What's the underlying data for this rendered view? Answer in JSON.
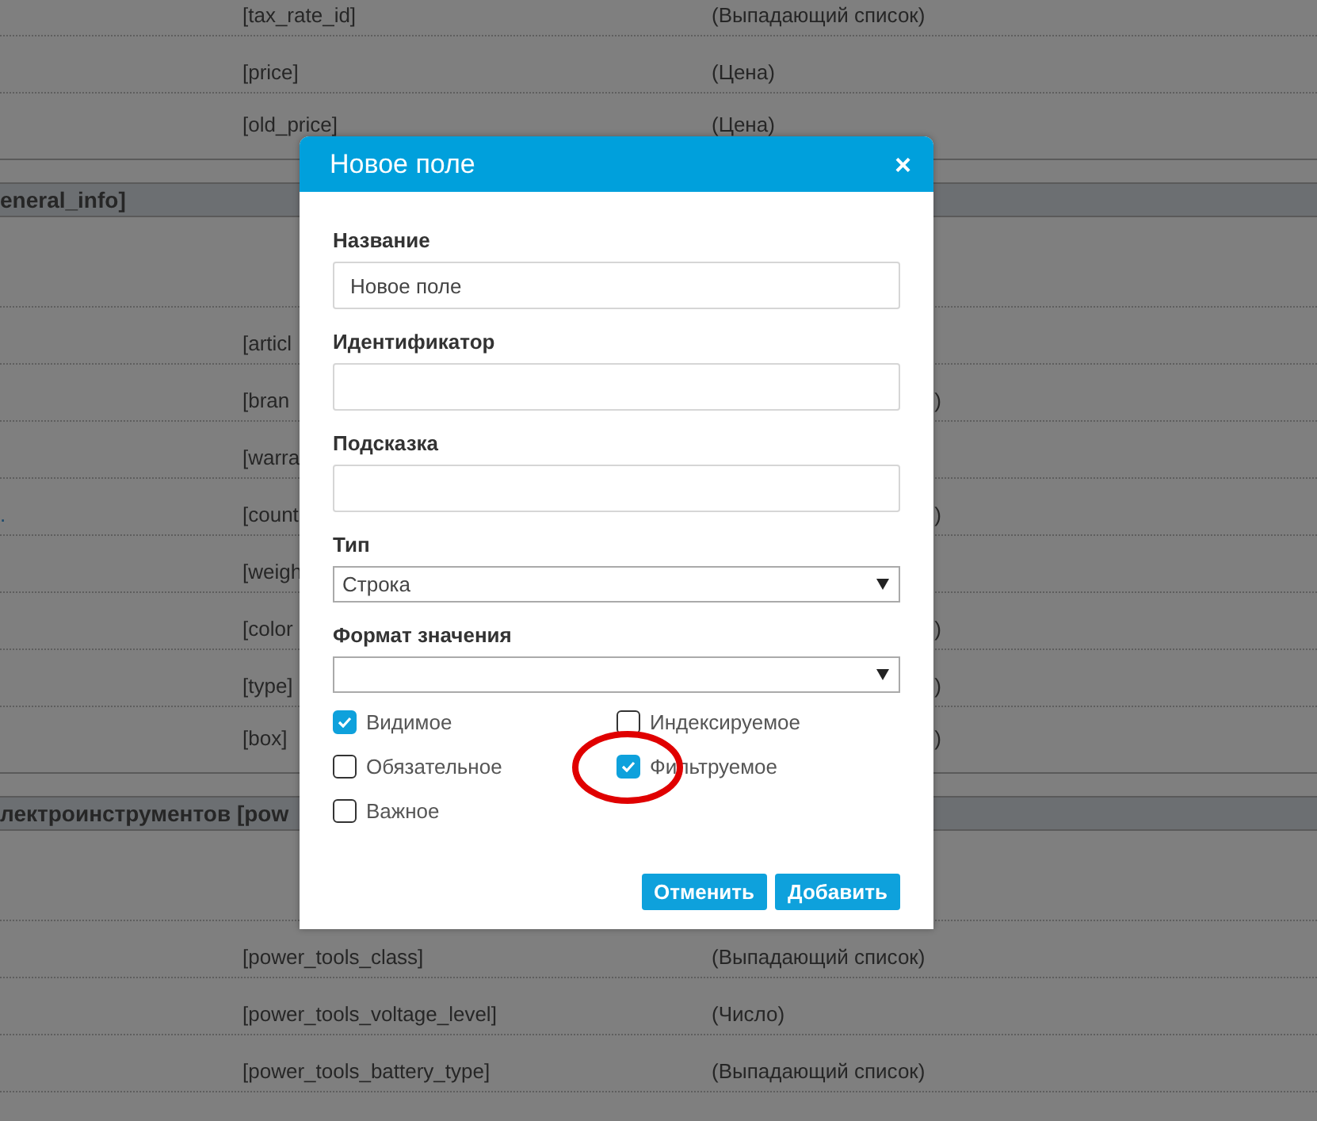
{
  "table": {
    "groups": [
      {
        "rows": [
          {
            "key": "[tax_rate_id]",
            "type": "(Выпадающий список)"
          },
          {
            "key": "[price]",
            "type": "(Цена)"
          },
          {
            "key": "[old_price]",
            "type": "(Цена)"
          }
        ]
      },
      {
        "title": "eneral_info]",
        "rows": [
          {
            "key": "[articl"
          },
          {
            "key": "[bran",
            "type_tail": ")"
          },
          {
            "key": "[warra"
          },
          {
            "name": ".",
            "key": "[count",
            "type_tail": ")"
          },
          {
            "key": "[weigh"
          },
          {
            "key": "[color",
            "type_tail": ")"
          },
          {
            "key": "[type]",
            "type_tail": ")"
          },
          {
            "key": "[box]",
            "type_tail": ")"
          }
        ]
      },
      {
        "title": "лектроинструментов [pow",
        "rows": [
          {
            "key": "[power_tools_class]",
            "type": "(Выпадающий список)"
          },
          {
            "key": "[power_tools_voltage_level]",
            "type": "(Число)"
          },
          {
            "key": "[power_tools_battery_type]",
            "type": "(Выпадающий список)"
          }
        ]
      }
    ]
  },
  "dialog": {
    "title": "Новое поле",
    "close": "×",
    "fields": [
      {
        "kind": "text",
        "label": "Название",
        "value": "Новое поле"
      },
      {
        "kind": "text",
        "label": "Идентификатор"
      },
      {
        "kind": "text",
        "label": "Подсказка"
      },
      {
        "kind": "select",
        "label": "Тип",
        "value": "Строка"
      },
      {
        "kind": "select",
        "label": "Формат значения"
      }
    ],
    "checkboxes": [
      {
        "label": "Видимое",
        "checked": true,
        "circled": false
      },
      {
        "label": "Индексируемое",
        "checked": false,
        "circled": false
      },
      {
        "label": "Обязательное",
        "checked": false,
        "circled": false
      },
      {
        "label": "Фильтруемое",
        "checked": true,
        "circled": true
      },
      {
        "label": "Важное",
        "checked": false,
        "circled": false
      }
    ],
    "buttons": [
      "Отменить",
      "Добавить"
    ]
  }
}
